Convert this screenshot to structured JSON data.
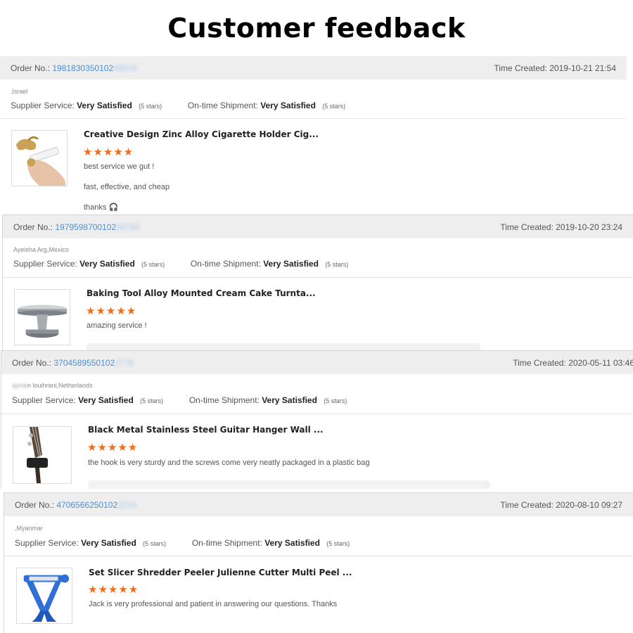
{
  "page_title": "Customer feedback",
  "reviews": [
    {
      "order_label": "Order No.:",
      "order_number": "1981830350102",
      "order_number_masked": "69818",
      "time_label": "Time Created:",
      "time": "2019-10-21 21:54",
      "buyer": ",Israel",
      "buyer_masked": "",
      "supplier_label": "Supplier Service:",
      "supplier_value": "Very Satisfied",
      "supplier_stars": "(5 stars)",
      "shipment_label": "On-time Shipment:",
      "shipment_value": "Very Satisfied",
      "shipment_stars": "(5 stars)",
      "product_title": "Creative Design Zinc Alloy Cigarette Holder Cig...",
      "rating": 5,
      "stars_text": "★★★★★",
      "review_lines": [
        "best service we gut !",
        "fast, effective, and cheap",
        "thanks 🎧"
      ]
    },
    {
      "order_label": "Order No.:",
      "order_number": "1979598700102",
      "order_number_masked": "69794",
      "time_label": "Time Created:",
      "time": "2019-10-20 23:24",
      "buyer": "Ayeisha Arg,Mexico",
      "buyer_masked": "",
      "supplier_label": "Supplier Service:",
      "supplier_value": "Very Satisfied",
      "supplier_stars": "(5 stars)",
      "shipment_label": "On-time Shipment:",
      "shipment_value": "Very Satisfied",
      "shipment_stars": "(5 stars)",
      "product_title": "Baking Tool Alloy Mounted Cream Cake Turnta...",
      "rating": 5,
      "stars_text": "★★★★★",
      "review_lines": [
        "amazing service !"
      ]
    },
    {
      "order_label": "Order No.:",
      "order_number": "3704589550102",
      "order_number_masked": "2778",
      "time_label": "Time Created:",
      "time": "2020-05-11 03:46",
      "buyer": "n louihrani,Netherlands",
      "buyer_masked": "ayme",
      "supplier_label": "Supplier Service:",
      "supplier_value": "Very Satisfied",
      "supplier_stars": "(5 stars)",
      "shipment_label": "On-time Shipment:",
      "shipment_value": "Very Satisfied",
      "shipment_stars": "(5 stars)",
      "product_title": "Black Metal Stainless Steel Guitar Hanger Wall ...",
      "rating": 5,
      "stars_text": "★★★★★",
      "review_lines": [
        "the hook is very sturdy and the screws come very neatly packaged in a plastic bag"
      ]
    },
    {
      "order_label": "Order No.:",
      "order_number": "4706566250102",
      "order_number_masked": "2214",
      "time_label": "Time Created:",
      "time": "2020-08-10 09:27",
      "buyer": ",Myanmar",
      "buyer_masked": "",
      "supplier_label": "Supplier Service:",
      "supplier_value": "Very Satisfied",
      "supplier_stars": "(5 stars)",
      "shipment_label": "On-time Shipment:",
      "shipment_value": "Very Satisfied",
      "shipment_stars": "(5 stars)",
      "product_title": "Set Slicer Shredder Peeler Julienne Cutter Multi Peel ...",
      "rating": 5,
      "stars_text": "★★★★★",
      "review_lines": [
        "Jack is very professional and patient in answering our questions. Thanks"
      ]
    }
  ],
  "colors": {
    "star": "#f56a16",
    "order_link": "#4a90d9",
    "header_bg": "#eeeeee"
  },
  "icons": [
    "cigarette-holder-product-image",
    "cake-turntable-product-image",
    "guitar-hanger-product-image",
    "peeler-product-image"
  ]
}
